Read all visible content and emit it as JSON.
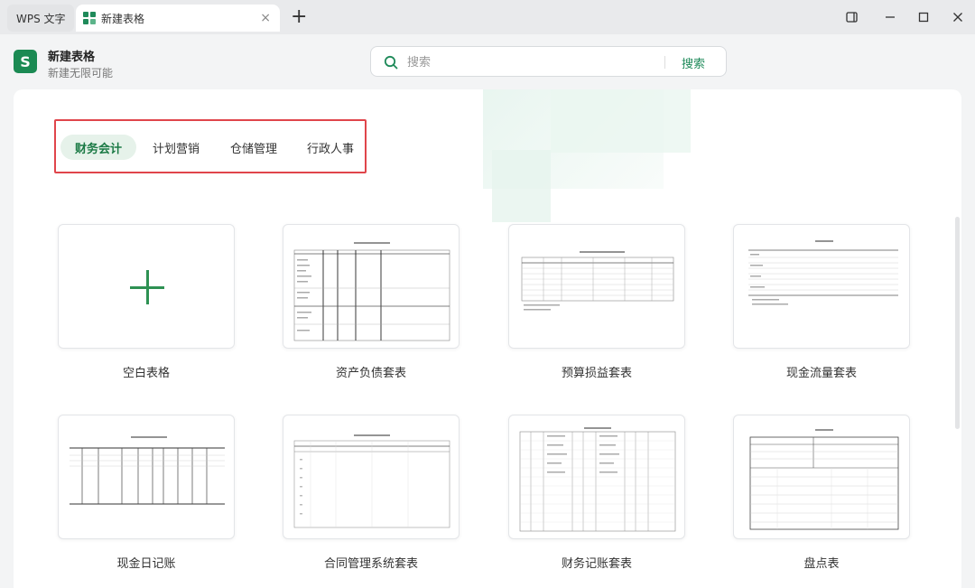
{
  "tabs": [
    {
      "label": "WPS 文字"
    },
    {
      "label": "新建表格",
      "active": true
    }
  ],
  "icons": {
    "close_tab": "close-icon",
    "add_tab": "plus-icon",
    "window": [
      "restore-window-icon",
      "minimize-icon",
      "maximize-icon",
      "close-window-icon"
    ]
  },
  "tab_close_symbol": "×",
  "tab_add_symbol": "+",
  "app": {
    "icon_letter": "S",
    "title": "新建表格",
    "subtitle": "新建无限可能"
  },
  "search": {
    "placeholder": "搜索",
    "button_label": "搜索"
  },
  "categories": [
    {
      "label": "财务会计",
      "active": true
    },
    {
      "label": "计划营销"
    },
    {
      "label": "仓储管理"
    },
    {
      "label": "行政人事"
    }
  ],
  "templates": [
    {
      "label": "空白表格"
    },
    {
      "label": "资产负债套表"
    },
    {
      "label": "预算损益套表"
    },
    {
      "label": "现金流量套表"
    },
    {
      "label": "现金日记账"
    },
    {
      "label": "合同管理系统套表"
    },
    {
      "label": "财务记账套表"
    },
    {
      "label": "盘点表"
    }
  ],
  "colors": {
    "accent": "#1f8a5a",
    "highlight_border": "#e0454b",
    "active_pill": "#e6f2ea"
  }
}
